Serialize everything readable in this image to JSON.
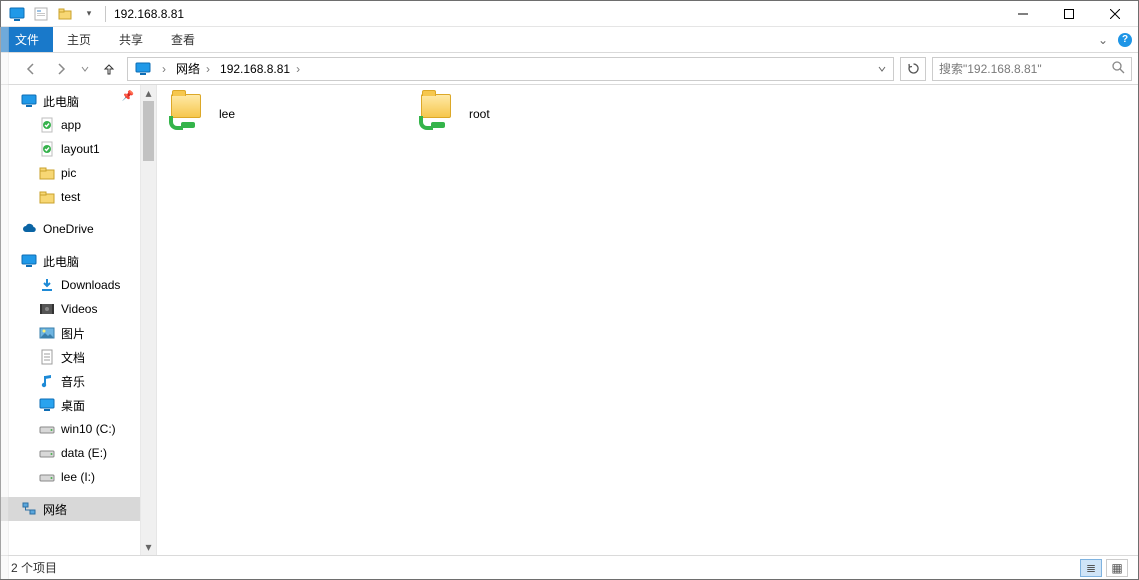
{
  "window": {
    "title": "192.168.8.81"
  },
  "qat_dropdown_glyph": "▾",
  "ribbon": {
    "file": "文件",
    "tabs": [
      "主页",
      "共享",
      "查看"
    ],
    "expand_glyph": "⌄",
    "help_glyph": "?"
  },
  "nav": {
    "back_tip": "后退",
    "fwd_tip": "前进",
    "up_tip": "上移"
  },
  "breadcrumbs": [
    "网络",
    "192.168.8.81"
  ],
  "addr_separator": "›",
  "search": {
    "placeholder": "搜索\"192.168.8.81\""
  },
  "sidebar": {
    "pin_glyph": "📌",
    "groups": [
      {
        "label": "此电脑",
        "icon": "monitor",
        "children": [
          {
            "label": "app",
            "icon": "green-doc"
          },
          {
            "label": "layout1",
            "icon": "green-doc"
          },
          {
            "label": "pic",
            "icon": "folder"
          },
          {
            "label": "test",
            "icon": "folder"
          }
        ]
      },
      {
        "label": "OneDrive",
        "icon": "cloud",
        "children": []
      },
      {
        "label": "此电脑",
        "icon": "monitor",
        "children": [
          {
            "label": "Downloads",
            "icon": "download"
          },
          {
            "label": "Videos",
            "icon": "video"
          },
          {
            "label": "图片",
            "icon": "picture"
          },
          {
            "label": "文档",
            "icon": "document"
          },
          {
            "label": "音乐",
            "icon": "music"
          },
          {
            "label": "桌面",
            "icon": "desktop"
          },
          {
            "label": "win10 (C:)",
            "icon": "drive"
          },
          {
            "label": "data (E:)",
            "icon": "drive"
          },
          {
            "label": "lee (I:)",
            "icon": "drive"
          }
        ]
      },
      {
        "label": "网络",
        "icon": "network",
        "selected": true,
        "children": []
      }
    ]
  },
  "items": [
    {
      "name": "lee"
    },
    {
      "name": "root"
    }
  ],
  "status": {
    "count_text": "2 个项目"
  },
  "view": {
    "details_glyph": "≣",
    "icons_glyph": "▦"
  }
}
